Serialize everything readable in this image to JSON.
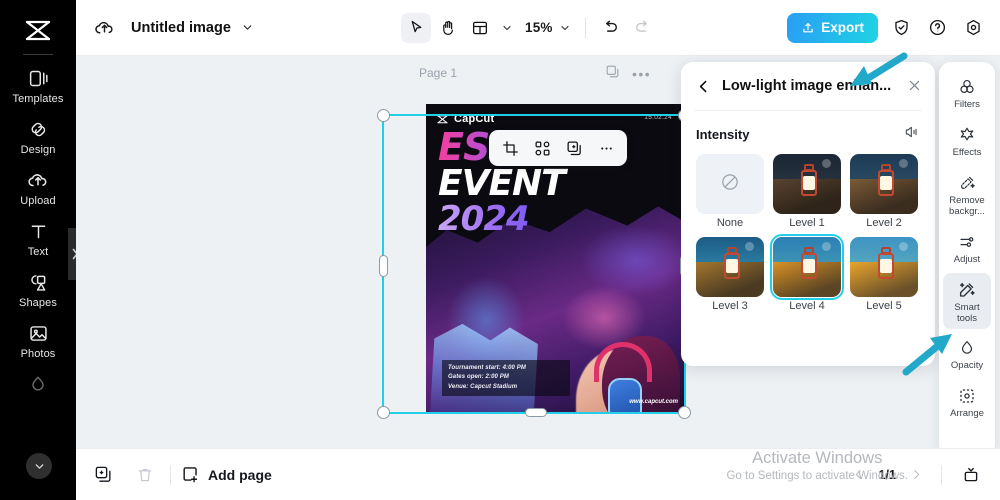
{
  "app": {
    "logo_icon": "capcut-logo-icon"
  },
  "left_sidebar": {
    "items": [
      {
        "label": "Templates",
        "icon": "templates-icon"
      },
      {
        "label": "Design",
        "icon": "design-icon"
      },
      {
        "label": "Upload",
        "icon": "upload-cloud-icon"
      },
      {
        "label": "Text",
        "icon": "text-t-icon"
      },
      {
        "label": "Shapes",
        "icon": "shapes-icon"
      },
      {
        "label": "Photos",
        "icon": "photos-image-icon"
      }
    ],
    "expand_tab_icon": "chevron-right-icon",
    "more_button_icon": "chevron-down-icon"
  },
  "topbar": {
    "cloud_icon": "cloud-upload-icon",
    "document_title": "Untitled image",
    "title_caret_icon": "chevron-down-icon",
    "tools": [
      {
        "name": "select-tool",
        "icon": "cursor-arrow-icon",
        "active": true
      },
      {
        "name": "hand-tool",
        "icon": "hand-icon",
        "active": false
      },
      {
        "name": "layout-tool",
        "icon": "layout-panel-icon",
        "active": false
      }
    ],
    "zoom_level": "15%",
    "undo_icon": "undo-arrow-icon",
    "redo_icon": "redo-arrow-icon",
    "export_label": "Export",
    "export_icon": "export-upload-icon",
    "right_icons": [
      {
        "name": "shield-check-icon"
      },
      {
        "name": "help-question-icon"
      },
      {
        "name": "settings-gear-icon"
      }
    ],
    "accent_color": "#1fd3e3"
  },
  "canvas": {
    "page_label": "Page 1",
    "page_duplicate_icon": "duplicate-page-icon",
    "page_more_icon": "more-dots-icon",
    "selection_color": "#23cfe8",
    "element_toolbar": [
      {
        "name": "crop-button",
        "icon": "crop-icon"
      },
      {
        "name": "replace-button",
        "icon": "shuffle-nodes-icon"
      },
      {
        "name": "duplicate-button",
        "icon": "duplicate-icon"
      },
      {
        "name": "more-button",
        "icon": "more-dots-icon"
      }
    ],
    "poster": {
      "brand": "CapCut",
      "brand_icon": "capcut-logo-icon",
      "date": "15.02.24",
      "headline_1": "ESPORTS",
      "headline_2": "EVENT",
      "headline_3": "2024",
      "details": [
        "Tournament start: 4:00 PM",
        "Gates open: 2:00 PM",
        "Venue: Capcut Stadium"
      ],
      "url": "www.capcut.com"
    }
  },
  "effect_panel": {
    "back_icon": "chevron-left-icon",
    "title": "Low-light image enhan...",
    "close_icon": "close-x-icon",
    "section_label": "Intensity",
    "section_icon": "compare-toggle-icon",
    "options": [
      {
        "label": "None",
        "selected": false,
        "kind": "none"
      },
      {
        "label": "Level 1",
        "selected": false,
        "kind": "image"
      },
      {
        "label": "Level 2",
        "selected": false,
        "kind": "image"
      },
      {
        "label": "Level 3",
        "selected": false,
        "kind": "image"
      },
      {
        "label": "Level 4",
        "selected": true,
        "kind": "image"
      },
      {
        "label": "Level 5",
        "selected": false,
        "kind": "image"
      }
    ]
  },
  "right_sidebar": {
    "items": [
      {
        "label": "Filters",
        "icon": "filters-circles-icon",
        "active": false
      },
      {
        "label": "Effects",
        "icon": "effects-star-icon",
        "active": false
      },
      {
        "label": "Remove\nbackgr...",
        "icon": "remove-bg-wand-icon",
        "active": false
      },
      {
        "label": "Adjust",
        "icon": "adjust-sliders-icon",
        "active": false
      },
      {
        "label": "Smart\ntools",
        "icon": "smart-tools-wand-icon",
        "active": true
      },
      {
        "label": "Opacity",
        "icon": "opacity-drop-icon",
        "active": false
      },
      {
        "label": "Arrange",
        "icon": "arrange-square-icon",
        "active": false
      }
    ]
  },
  "bottombar": {
    "duplicate_icon": "duplicate-page-icon",
    "delete_icon": "trash-icon",
    "add_page_label": "Add page",
    "add_page_icon": "add-page-plus-icon",
    "prev_icon": "chevron-left-icon",
    "page_indicator": "1/1",
    "next_icon": "chevron-right-icon",
    "fit_icon": "fit-screen-icon"
  },
  "watermark": {
    "line1": "Activate Windows",
    "line2": "Go to Settings to activate Windows."
  },
  "annotations": {
    "arrow_color": "#22a8c8"
  }
}
